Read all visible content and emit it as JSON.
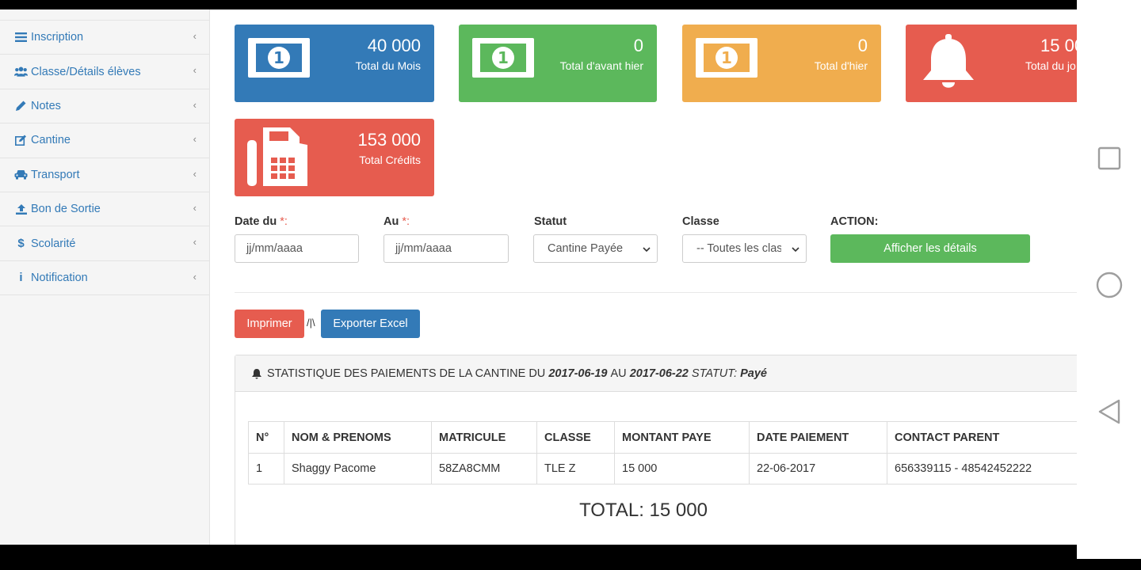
{
  "sidebar": {
    "items": [
      {
        "label": "Inscription",
        "icon": "list-icon"
      },
      {
        "label": "Classe/Détails élèves",
        "icon": "users-icon"
      },
      {
        "label": "Notes",
        "icon": "pencil-icon"
      },
      {
        "label": "Cantine",
        "icon": "edit-icon"
      },
      {
        "label": "Transport",
        "icon": "car-icon"
      },
      {
        "label": "Bon de Sortie",
        "icon": "upload-icon"
      },
      {
        "label": "Scolarité",
        "icon": "dollar-icon"
      },
      {
        "label": "Notification",
        "icon": "info-icon"
      }
    ]
  },
  "cards": [
    {
      "value": "40 000",
      "label": "Total du Mois",
      "color": "#337ab7",
      "icon": "money-icon"
    },
    {
      "value": "0",
      "label": "Total d'avant hier",
      "color": "#5cb85c",
      "icon": "money-icon"
    },
    {
      "value": "0",
      "label": "Total d'hier",
      "color": "#f0ad4e",
      "icon": "money-icon"
    },
    {
      "value": "15 00",
      "label": "Total du jo",
      "color": "#e65c4f",
      "icon": "bell-icon"
    },
    {
      "value": "153 000",
      "label": "Total Crédits",
      "color": "#e65c4f",
      "icon": "fax-icon"
    }
  ],
  "filters": {
    "date_from_label": "Date du",
    "date_from_required": "*:",
    "date_from_placeholder": "jj/mm/aaaa",
    "date_to_label": "Au",
    "date_to_required": "*:",
    "date_to_placeholder": "jj/mm/aaaa",
    "status_label": "Statut",
    "status_value": "Cantine Payée",
    "class_label": "Classe",
    "class_value": "-- Toutes les clas",
    "action_label": "ACTION:",
    "action_button": "Afficher les détails"
  },
  "buttons": {
    "print": "Imprimer",
    "separator": "/|\\",
    "export": "Exporter Excel"
  },
  "panel": {
    "title_prefix": "STATISTIQUE DES PAIEMENTS DE LA CANTINE DU",
    "date_from": "2017-06-19",
    "title_middle": "AU",
    "date_to": "2017-06-22",
    "status_label": "STATUT:",
    "status_value": "Payé"
  },
  "table": {
    "headers": [
      "N°",
      "NOM & PRENOMS",
      "MATRICULE",
      "CLASSE",
      "MONTANT PAYE",
      "DATE PAIEMENT",
      "CONTACT PARENT"
    ],
    "rows": [
      [
        "1",
        "Shaggy Pacome",
        "58ZA8CMM",
        "TLE Z",
        "15 000",
        "22-06-2017",
        "656339115 - 48542452222"
      ]
    ]
  },
  "total": "TOTAL: 15 000"
}
